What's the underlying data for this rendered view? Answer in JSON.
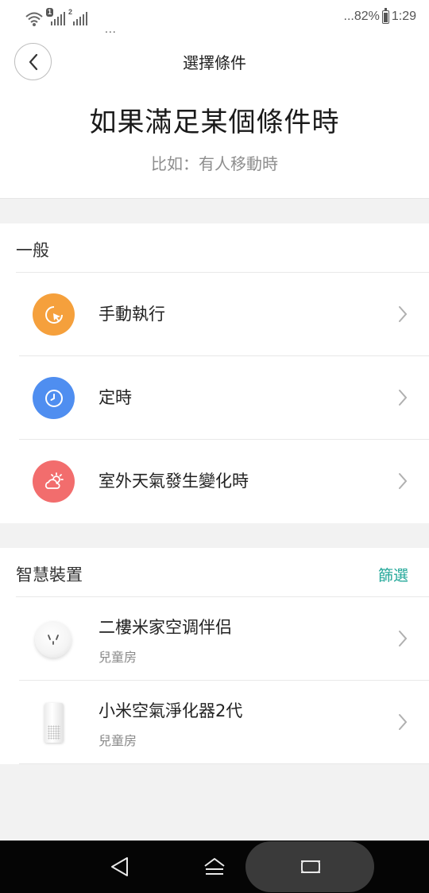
{
  "status_bar": {
    "sim1_badge": "1",
    "sim2_badge": "2",
    "notif_dots": "...",
    "battery_text": "...82%",
    "time": "1:29"
  },
  "header": {
    "nav_title": "選擇條件",
    "hero_title": "如果滿足某個條件時",
    "hero_subtitle": "比如：有人移動時"
  },
  "general": {
    "heading": "一般",
    "items": [
      {
        "label": "手動執行",
        "icon": "manual-tap-icon",
        "color": "#f5a03c"
      },
      {
        "label": "定時",
        "icon": "clock-icon",
        "color": "#4f8ef0"
      },
      {
        "label": "室外天氣發生變化時",
        "icon": "weather-icon",
        "color": "#f26d6d"
      }
    ]
  },
  "devices": {
    "heading": "智慧裝置",
    "filter_label": "篩選",
    "items": [
      {
        "name": "二樓米家空调伴侣",
        "room": "兒童房",
        "icon": "smart-plug-icon"
      },
      {
        "name": "小米空氣淨化器2代",
        "room": "兒童房",
        "icon": "air-purifier-icon"
      }
    ]
  },
  "colors": {
    "accent": "#24a89a",
    "page_bg": "#f2f2f2"
  }
}
